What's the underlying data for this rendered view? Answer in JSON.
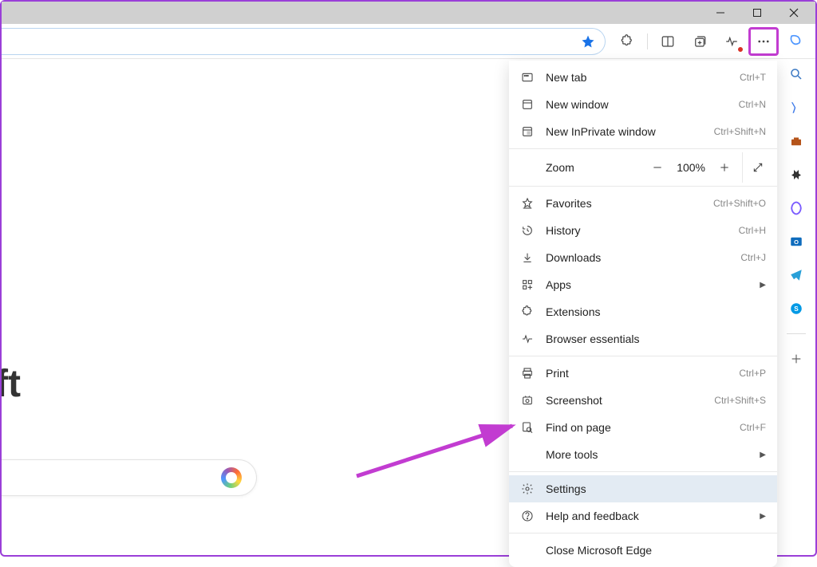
{
  "window": {
    "minimize": "Minimize",
    "maximize": "Maximize",
    "close": "Close"
  },
  "toolbar": {
    "favorite": "Favorite",
    "extensions": "Extensions",
    "split": "Split screen",
    "collections": "Collections",
    "essentials": "Browser essentials",
    "more": "Settings and more",
    "copilot": "Copilot"
  },
  "content": {
    "headline_fragment": "ft",
    "copilot": "Copilot"
  },
  "menu": {
    "new_tab": {
      "label": "New tab",
      "shortcut": "Ctrl+T"
    },
    "new_window": {
      "label": "New window",
      "shortcut": "Ctrl+N"
    },
    "new_inprivate": {
      "label": "New InPrivate window",
      "shortcut": "Ctrl+Shift+N"
    },
    "zoom": {
      "label": "Zoom",
      "value": "100%"
    },
    "favorites": {
      "label": "Favorites",
      "shortcut": "Ctrl+Shift+O"
    },
    "history": {
      "label": "History",
      "shortcut": "Ctrl+H"
    },
    "downloads": {
      "label": "Downloads",
      "shortcut": "Ctrl+J"
    },
    "apps": {
      "label": "Apps"
    },
    "extensions": {
      "label": "Extensions"
    },
    "browser_essentials": {
      "label": "Browser essentials"
    },
    "print": {
      "label": "Print",
      "shortcut": "Ctrl+P"
    },
    "screenshot": {
      "label": "Screenshot",
      "shortcut": "Ctrl+Shift+S"
    },
    "find": {
      "label": "Find on page",
      "shortcut": "Ctrl+F"
    },
    "more_tools": {
      "label": "More tools"
    },
    "settings": {
      "label": "Settings"
    },
    "help": {
      "label": "Help and feedback"
    },
    "close_edge": {
      "label": "Close Microsoft Edge"
    }
  },
  "sidebar": {
    "search": "Search",
    "shopping": "Shopping",
    "tools": "Tools",
    "games": "Games",
    "m365": "Microsoft 365",
    "outlook": "Outlook",
    "telegram": "Telegram",
    "skype": "Skype",
    "add": "Add"
  }
}
